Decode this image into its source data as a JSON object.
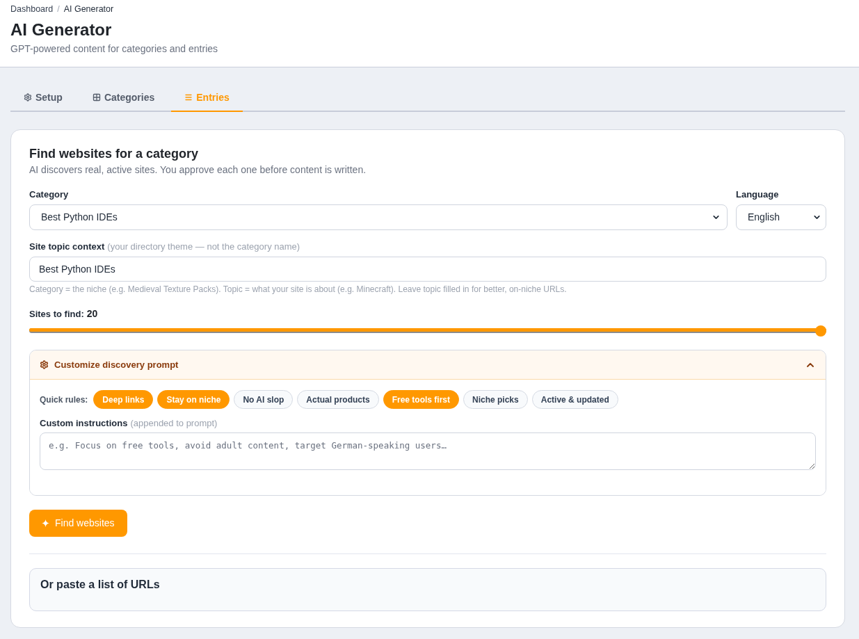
{
  "breadcrumb": {
    "items": [
      "Dashboard",
      "AI Generator"
    ],
    "separator": "/"
  },
  "page": {
    "title": "AI Generator",
    "subtitle": "GPT-powered content for categories and entries"
  },
  "tabs": [
    {
      "label": "Setup",
      "selected": false
    },
    {
      "label": "Categories",
      "selected": false
    },
    {
      "label": "Entries",
      "selected": true
    }
  ],
  "section": {
    "title": "Find websites for a category",
    "description": "AI discovers real, active sites. You approve each one before content is written."
  },
  "category_field": {
    "label": "Category",
    "value": "Best Python IDEs"
  },
  "language_field": {
    "label": "Language",
    "value": "English"
  },
  "topic_field": {
    "label": "Site topic context",
    "note": "(your directory theme — not the category name)",
    "value": "Best Python IDEs",
    "hint": "Category = the niche (e.g. Medieval Texture Packs). Topic = what your site is about (e.g. Minecraft). Leave topic filled in for better, on-niche URLs."
  },
  "sites_slider": {
    "label": "Sites to find:",
    "reading": "20",
    "level": 1
  },
  "prompt_panel": {
    "title": "Customize discovery prompt",
    "expanded": true,
    "quick_rules_label": "Quick rules:",
    "rules": [
      {
        "label": "Deep links",
        "selected": true
      },
      {
        "label": "Stay on niche",
        "selected": true
      },
      {
        "label": "No AI slop",
        "selected": false
      },
      {
        "label": "Actual products",
        "selected": false
      },
      {
        "label": "Free tools first",
        "selected": true
      },
      {
        "label": "Niche picks",
        "selected": false
      },
      {
        "label": "Active & updated",
        "selected": false
      }
    ],
    "custom_instructions": {
      "label": "Custom instructions",
      "note": "(appended to prompt)",
      "placeholder": "e.g. Focus on free tools, avoid adult content, target German-speaking users…"
    }
  },
  "find_button": {
    "label": "Find websites"
  },
  "paste_section": {
    "title": "Or paste a list of URLs"
  }
}
